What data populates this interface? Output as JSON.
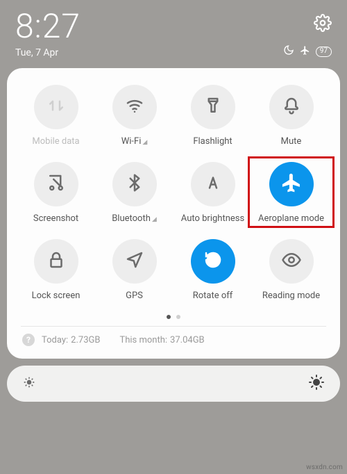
{
  "status": {
    "time": "8:27",
    "date": "Tue, 7 Apr",
    "battery": "97"
  },
  "tiles": {
    "mobile_data": "Mobile data",
    "wifi": "Wi-Fi",
    "flashlight": "Flashlight",
    "mute": "Mute",
    "screenshot": "Screenshot",
    "bluetooth": "Bluetooth",
    "auto_brightness": "Auto brightness",
    "aeroplane": "Aeroplane mode",
    "lock_screen": "Lock screen",
    "gps": "GPS",
    "rotate_off": "Rotate off",
    "reading_mode": "Reading mode"
  },
  "data_usage": {
    "today_label": "Today:",
    "today_value": "2.73GB",
    "month_label": "This month:",
    "month_value": "37.04GB"
  },
  "watermark": "wsxdn.com"
}
